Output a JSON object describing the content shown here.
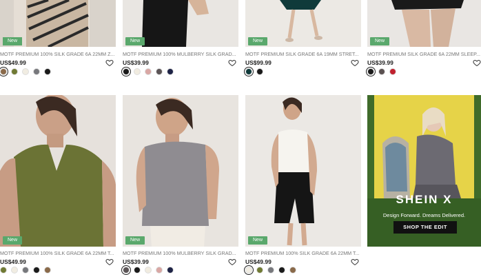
{
  "products": [
    {
      "badge": "New",
      "title": "MOTF PREMIUM 100% SILK GRADE 6A 22MM Z...",
      "price": "US$49.99",
      "swatches": [
        "#8a6a4a",
        "#707a34",
        "#f1ede2",
        "#77787c",
        "#1a1a1a"
      ],
      "selected": 0
    },
    {
      "badge": "New",
      "title": "MOTF PREMIUM 100% MULBERRY SILK GRAD...",
      "price": "US$39.99",
      "swatches": [
        "#1a1a1a",
        "#f1ece0",
        "#d9a7a4",
        "#5b5456",
        "#1e2346"
      ],
      "selected": 0
    },
    {
      "badge": "New",
      "title": "MOTF PREMIUM SILK GRADE 6A 19MM STRET...",
      "price": "US$99.99",
      "swatches": [
        "#0f3a3a",
        "#1a1a1a"
      ],
      "selected": 0
    },
    {
      "badge": "New",
      "title": "MOTF PREMIUM SILK GRADE 6A 22MM SLEEP...",
      "price": "US$39.99",
      "swatches": [
        "#1a1a1a",
        "#5a5050",
        "#c0212f"
      ],
      "selected": 0
    },
    {
      "badge": "New",
      "title": "MOTF PREMIUM 100% SILK GRADE 6A 22MM T...",
      "price": "US$49.99",
      "swatches": [
        "#707a34",
        "#f1ede2",
        "#77787c",
        "#1a1a1a",
        "#8a6a4a"
      ],
      "selected": -1
    },
    {
      "badge": "New",
      "title": "MOTF PREMIUM 100% MULBERRY SILK GRAD...",
      "price": "US$39.99",
      "swatches": [
        "#5b5456",
        "#1a1a1a",
        "#f1ece0",
        "#d9a7a4",
        "#1e2346"
      ],
      "selected": 0
    },
    {
      "badge": "New",
      "title": "MOTF PREMIUM 100% SILK GRADE 6A 22MM T...",
      "price": "US$49.99",
      "swatches": [
        "#f1ede2",
        "#707a34",
        "#77787c",
        "#1a1a1a",
        "#8a6a4a"
      ],
      "selected": 0
    }
  ],
  "promo": {
    "logo": "SHEIN X",
    "tagline": "Design Forward. Dreams Delivered.",
    "button": "SHOP THE EDIT"
  },
  "colors": {
    "badge": "#5aa86c",
    "price": "#222222",
    "title": "#777777",
    "promo_bg": "#e8d54a"
  },
  "icons": {
    "wishlist": "heart-icon"
  }
}
